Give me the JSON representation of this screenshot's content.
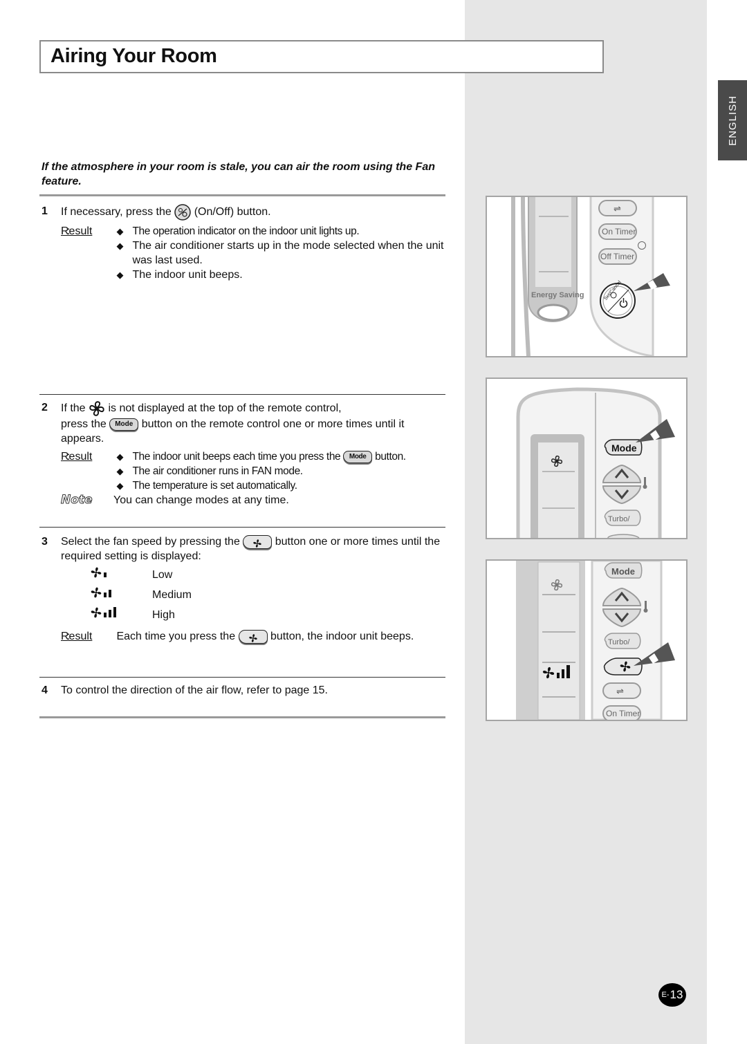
{
  "page": {
    "title": "Airing Your Room",
    "language_tab": "ENGLISH",
    "intro": "If the atmosphere in your room is stale, you can air the room using the Fan feature.",
    "page_number_prefix": "E-",
    "page_number": "13"
  },
  "steps": [
    {
      "number": "1",
      "text_before_icon": "If necessary, press the",
      "icon": "on-off-button-icon",
      "text_after_icon": "(On/Off) button.",
      "result_label": "Result",
      "results": [
        "The operation indicator on the indoor unit lights up.",
        "The air conditioner starts up in the mode selected when the unit was last used.",
        "The indoor unit beeps."
      ]
    },
    {
      "number": "2",
      "line1_before": "If the",
      "line1_icon": "fan-mode-icon",
      "line1_after": "is not displayed at the top of the remote control,",
      "line2_before": "press the",
      "mode_button_label": "Mode",
      "line2_after": "button on the remote control one or more times until it appears.",
      "result_label": "Result",
      "results": [
        {
          "before": "The indoor unit beeps each time you press the",
          "button": "Mode",
          "after": "button."
        },
        {
          "text": "The air conditioner runs in FAN mode."
        },
        {
          "text": "The temperature is set automatically."
        }
      ],
      "note_label": "Note",
      "note_text": "You can change modes at any time."
    },
    {
      "number": "3",
      "line1_before": "Select the fan speed by pressing the",
      "line1_icon": "fan-speed-button-icon",
      "line1_after": "button one or more times until the required setting is displayed:",
      "speeds": [
        {
          "icon": "fan-speed-low-icon",
          "label": "Low",
          "level": 1
        },
        {
          "icon": "fan-speed-medium-icon",
          "label": "Medium",
          "level": 2
        },
        {
          "icon": "fan-speed-high-icon",
          "label": "High",
          "level": 3
        }
      ],
      "result_label": "Result",
      "result_before": "Each time you press the",
      "result_after": "button, the indoor unit beeps."
    },
    {
      "number": "4",
      "text": "To control the direction of the air flow, refer to page 15."
    }
  ],
  "figures": {
    "fig1": {
      "energy_saving": "Energy Saving",
      "on_timer": "On Timer",
      "off_timer": "Off Timer",
      "set_cancel": "Set/Cancel"
    },
    "fig2": {
      "mode": "Mode",
      "turbo": "Turbo/"
    },
    "fig3": {
      "mode": "Mode",
      "turbo": "Turbo/",
      "on_timer": "On Timer"
    }
  },
  "colors": {
    "side_panel": "#e6e6e6",
    "lang_tab": "#4a4a4a",
    "pointer": "#555555"
  }
}
